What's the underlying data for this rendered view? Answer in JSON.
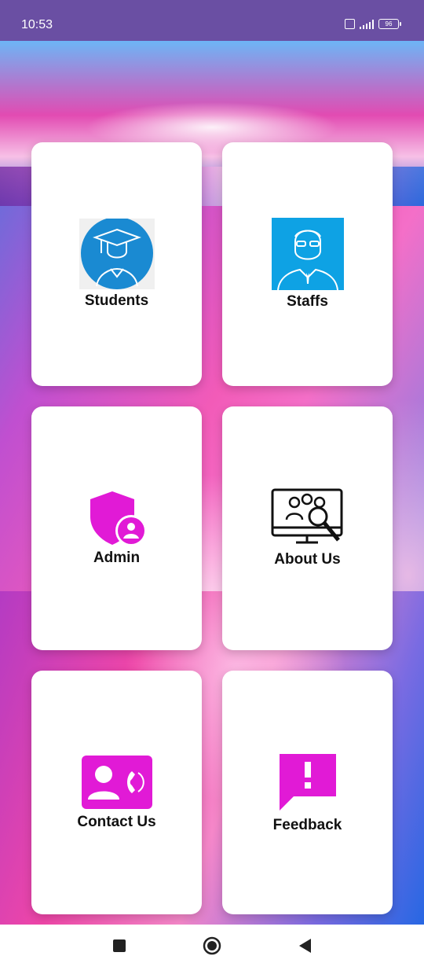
{
  "status_bar": {
    "time": "10:53",
    "battery": "96",
    "volte": "VoLTE"
  },
  "colors": {
    "status_bg": "#6a4fa3",
    "accent_magenta": "#e11ad6",
    "staff_blue": "#0ea2e4",
    "student_blue": "#1a8ad2"
  },
  "cards": [
    {
      "label": "Students",
      "icon": "graduate-icon"
    },
    {
      "label": "Staffs",
      "icon": "staff-icon"
    },
    {
      "label": "Admin",
      "icon": "admin-shield-icon"
    },
    {
      "label": "About Us",
      "icon": "monitor-search-icon"
    },
    {
      "label": "Contact Us",
      "icon": "contact-card-icon"
    },
    {
      "label": "Feedback",
      "icon": "feedback-icon"
    }
  ],
  "nav": {
    "items": [
      "recents-button",
      "home-button",
      "back-button"
    ]
  }
}
